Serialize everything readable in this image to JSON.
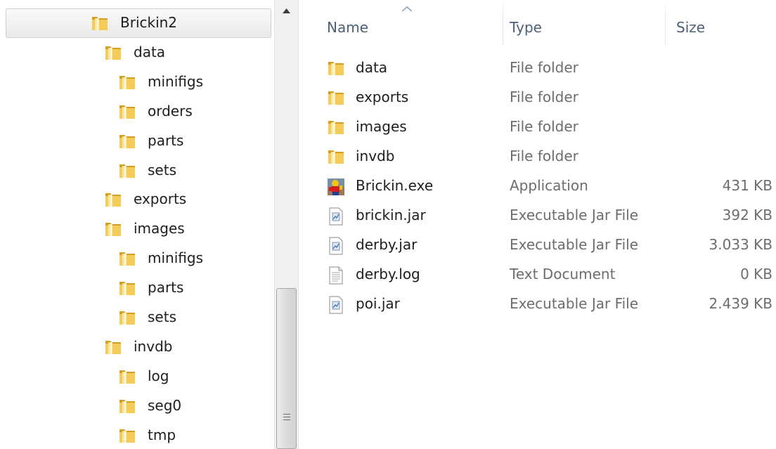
{
  "nav_tree": [
    {
      "label": "Brickin2",
      "depth": 0,
      "selected": true
    },
    {
      "label": "data",
      "depth": 1
    },
    {
      "label": "minifigs",
      "depth": 2
    },
    {
      "label": "orders",
      "depth": 2
    },
    {
      "label": "parts",
      "depth": 2
    },
    {
      "label": "sets",
      "depth": 2
    },
    {
      "label": "exports",
      "depth": 1
    },
    {
      "label": "images",
      "depth": 1
    },
    {
      "label": "minifigs",
      "depth": 2
    },
    {
      "label": "parts",
      "depth": 2
    },
    {
      "label": "sets",
      "depth": 2
    },
    {
      "label": "invdb",
      "depth": 1
    },
    {
      "label": "log",
      "depth": 2
    },
    {
      "label": "seg0",
      "depth": 2
    },
    {
      "label": "tmp",
      "depth": 2
    }
  ],
  "columns": {
    "name": "Name",
    "type": "Type",
    "size": "Size"
  },
  "files": [
    {
      "name": "data",
      "type": "File folder",
      "size": "",
      "icon": "folder-icon"
    },
    {
      "name": "exports",
      "type": "File folder",
      "size": "",
      "icon": "folder-icon"
    },
    {
      "name": "images",
      "type": "File folder",
      "size": "",
      "icon": "folder-icon"
    },
    {
      "name": "invdb",
      "type": "File folder",
      "size": "",
      "icon": "folder-icon"
    },
    {
      "name": "Brickin.exe",
      "type": "Application",
      "size": "431 KB",
      "icon": "application-icon"
    },
    {
      "name": "brickin.jar",
      "type": "Executable Jar File",
      "size": "392 KB",
      "icon": "jar-file-icon"
    },
    {
      "name": "derby.jar",
      "type": "Executable Jar File",
      "size": "3.033 KB",
      "icon": "jar-file-icon"
    },
    {
      "name": "derby.log",
      "type": "Text Document",
      "size": "0 KB",
      "icon": "text-document-icon"
    },
    {
      "name": "poi.jar",
      "type": "Executable Jar File",
      "size": "2.439 KB",
      "icon": "jar-file-icon"
    }
  ],
  "colors": {
    "header_text": "#4c607a",
    "folder_yellow": "#e8b630",
    "secondary_text": "#6d6d6d"
  }
}
